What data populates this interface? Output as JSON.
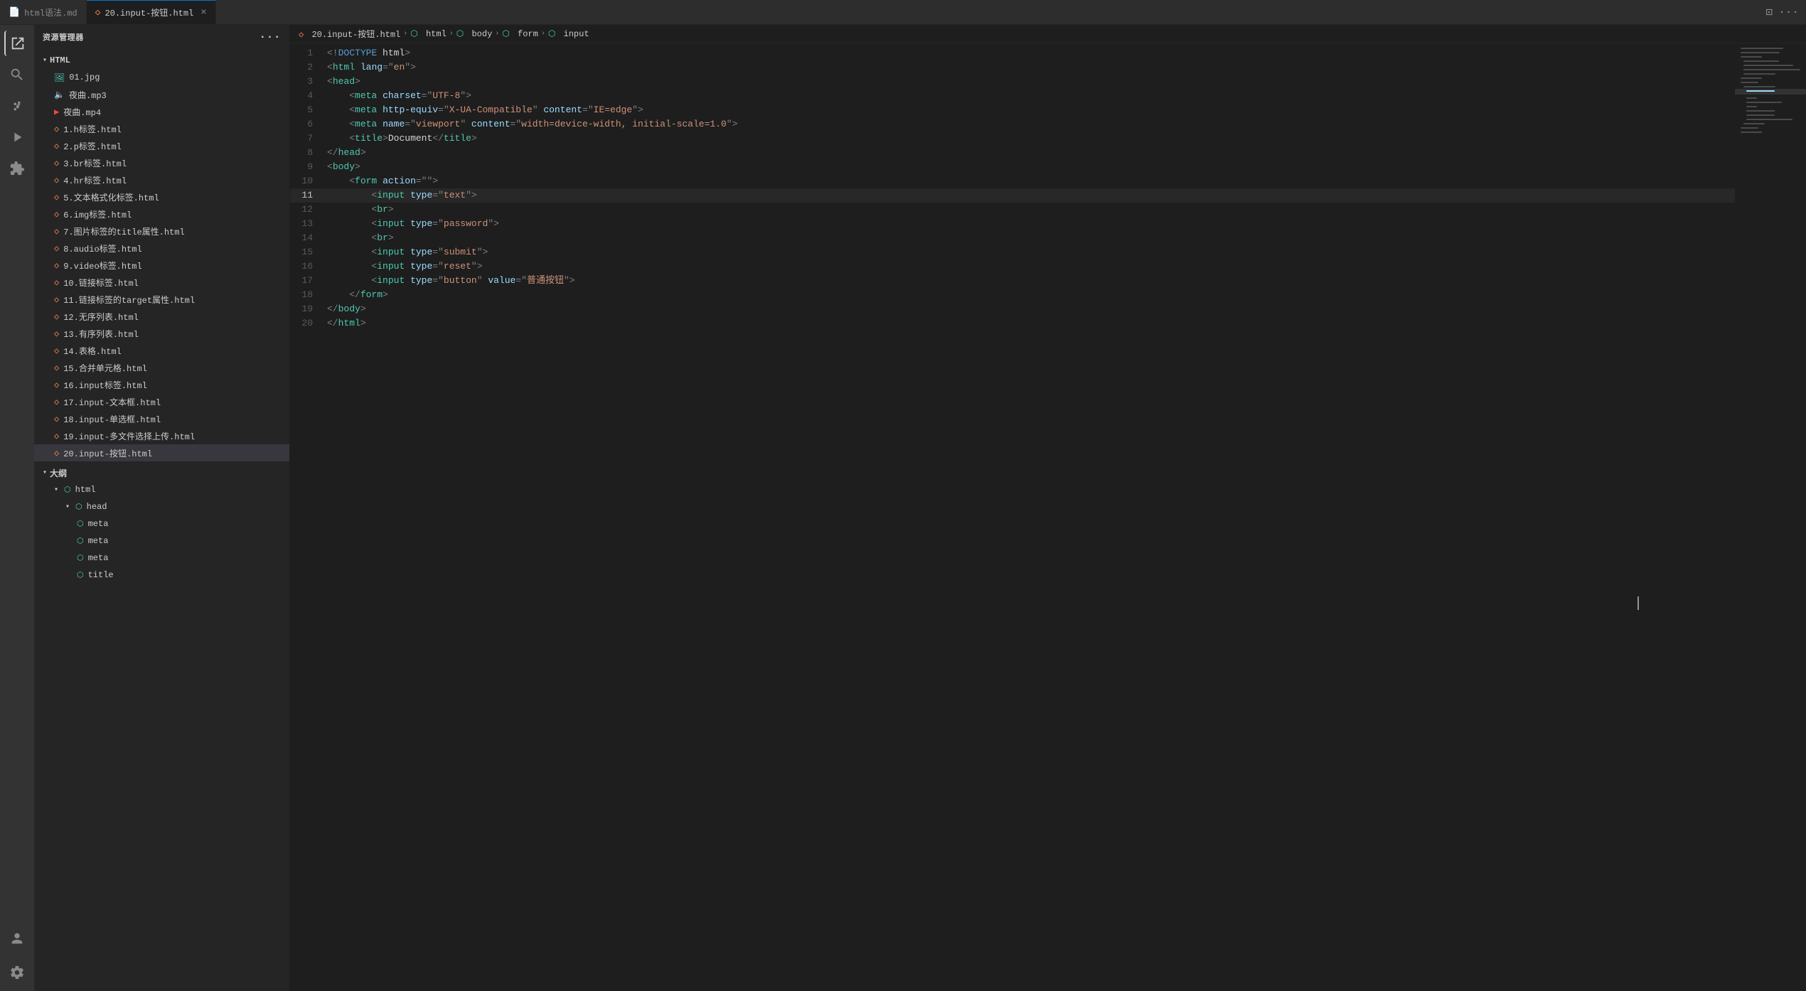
{
  "titleBar": {
    "title": "资源管理器"
  },
  "tabs": [
    {
      "id": "html-syntax",
      "label": "html语法.md",
      "icon": "📄",
      "active": false,
      "closable": false
    },
    {
      "id": "input-button",
      "label": "20.input-按钮.html",
      "icon": "◇",
      "active": true,
      "closable": true
    }
  ],
  "breadcrumb": {
    "items": [
      {
        "label": "20.input-按钮.html",
        "icon": "file"
      },
      {
        "label": "html",
        "icon": "element"
      },
      {
        "label": "body",
        "icon": "element"
      },
      {
        "label": "form",
        "icon": "element"
      },
      {
        "label": "input",
        "icon": "element"
      }
    ]
  },
  "sidebar": {
    "title": "资源管理器",
    "section": "HTML",
    "files": [
      {
        "name": "01.jpg",
        "icon": "image",
        "type": "image"
      },
      {
        "name": "夜曲.mp3",
        "icon": "audio",
        "type": "audio"
      },
      {
        "name": "夜曲.mp4",
        "icon": "video",
        "type": "video"
      },
      {
        "name": "1.h标签.html",
        "icon": "html",
        "type": "html"
      },
      {
        "name": "2.p标签.html",
        "icon": "html",
        "type": "html"
      },
      {
        "name": "3.br标签.html",
        "icon": "html",
        "type": "html"
      },
      {
        "name": "4.hr标签.html",
        "icon": "html",
        "type": "html"
      },
      {
        "name": "5.文本格式化标签.html",
        "icon": "html",
        "type": "html"
      },
      {
        "name": "6.img标签.html",
        "icon": "html",
        "type": "html"
      },
      {
        "name": "7.图片标签的title属性.html",
        "icon": "html",
        "type": "html"
      },
      {
        "name": "8.audio标签.html",
        "icon": "html",
        "type": "html"
      },
      {
        "name": "9.video标签.html",
        "icon": "html",
        "type": "html"
      },
      {
        "name": "10.链接标签.html",
        "icon": "html",
        "type": "html"
      },
      {
        "name": "11.链接标签的target属性.html",
        "icon": "html",
        "type": "html"
      },
      {
        "name": "12.无序列表.html",
        "icon": "html",
        "type": "html"
      },
      {
        "name": "13.有序列表.html",
        "icon": "html",
        "type": "html"
      },
      {
        "name": "14.表格.html",
        "icon": "html",
        "type": "html"
      },
      {
        "name": "15.合并单元格.html",
        "icon": "html",
        "type": "html"
      },
      {
        "name": "16.input标签.html",
        "icon": "html",
        "type": "html"
      },
      {
        "name": "17.input-文本框.html",
        "icon": "html",
        "type": "html"
      },
      {
        "name": "18.input-单选框.html",
        "icon": "html",
        "type": "html"
      },
      {
        "name": "19.input-多文件选择上传.html",
        "icon": "html",
        "type": "html"
      },
      {
        "name": "20.input-按钮.html",
        "icon": "html",
        "type": "html",
        "selected": true
      }
    ],
    "outline": {
      "title": "大纲",
      "items": [
        {
          "label": "html",
          "level": 1,
          "expanded": true,
          "icon": "element"
        },
        {
          "label": "head",
          "level": 2,
          "expanded": true,
          "icon": "element"
        },
        {
          "label": "meta",
          "level": 3,
          "icon": "element"
        },
        {
          "label": "meta",
          "level": 3,
          "icon": "element"
        },
        {
          "label": "meta",
          "level": 3,
          "icon": "element"
        },
        {
          "label": "title",
          "level": 3,
          "icon": "element"
        }
      ]
    }
  },
  "codeLines": [
    {
      "num": 1,
      "content": "<!DOCTYPE html>",
      "highlighted": false
    },
    {
      "num": 2,
      "content": "<html lang=\"en\">",
      "highlighted": false
    },
    {
      "num": 3,
      "content": "<head>",
      "highlighted": false
    },
    {
      "num": 4,
      "content": "    <meta charset=\"UTF-8\">",
      "highlighted": false
    },
    {
      "num": 5,
      "content": "    <meta http-equiv=\"X-UA-Compatible\" content=\"IE=edge\">",
      "highlighted": false
    },
    {
      "num": 6,
      "content": "    <meta name=\"viewport\" content=\"width=device-width, initial-scale=1.0\">",
      "highlighted": false
    },
    {
      "num": 7,
      "content": "    <title>Document</title>",
      "highlighted": false
    },
    {
      "num": 8,
      "content": "</head>",
      "highlighted": false
    },
    {
      "num": 9,
      "content": "<body>",
      "highlighted": false
    },
    {
      "num": 10,
      "content": "    <form action=\"\">",
      "highlighted": false
    },
    {
      "num": 11,
      "content": "        <input type=\"text\">",
      "highlighted": true
    },
    {
      "num": 12,
      "content": "        <br>",
      "highlighted": false
    },
    {
      "num": 13,
      "content": "        <input type=\"password\">",
      "highlighted": false
    },
    {
      "num": 14,
      "content": "        <br>",
      "highlighted": false
    },
    {
      "num": 15,
      "content": "        <input type=\"submit\">",
      "highlighted": false
    },
    {
      "num": 16,
      "content": "        <input type=\"reset\">",
      "highlighted": false
    },
    {
      "num": 17,
      "content": "        <input type=\"button\" value=\"普通按钮\">",
      "highlighted": false
    },
    {
      "num": 18,
      "content": "    </form>",
      "highlighted": false
    },
    {
      "num": 19,
      "content": "</body>",
      "highlighted": false
    },
    {
      "num": 20,
      "content": "</html>",
      "highlighted": false
    }
  ],
  "activityBar": {
    "icons": [
      {
        "name": "explorer",
        "label": "资源管理器",
        "active": true
      },
      {
        "name": "search",
        "label": "搜索",
        "active": false
      },
      {
        "name": "source-control",
        "label": "源代码管理",
        "active": false
      },
      {
        "name": "run",
        "label": "运行和调试",
        "active": false
      },
      {
        "name": "extensions",
        "label": "扩展",
        "active": false
      }
    ],
    "bottomIcons": [
      {
        "name": "account",
        "label": "账户"
      },
      {
        "name": "settings",
        "label": "管理"
      }
    ]
  },
  "minimap": {
    "visible": true
  }
}
